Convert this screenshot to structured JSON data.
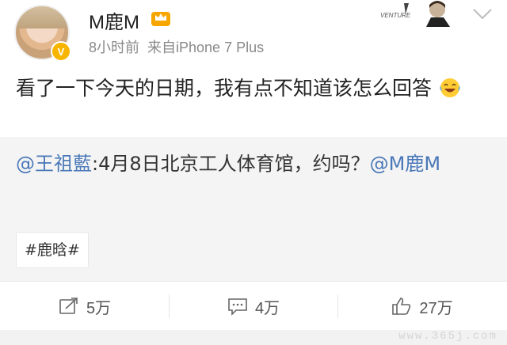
{
  "header": {
    "username": "M鹿M",
    "time": "8小时前",
    "source": "来自iPhone 7 Plus",
    "badge": "V",
    "banner_text": "VENTURE"
  },
  "post": {
    "text": "看了一下今天的日期，我有点不知道该怎么回答",
    "emoji": "laughing-tears"
  },
  "repost": {
    "mention": "@王祖藍",
    "text": ":4月8日北京工人体育馆，约吗？",
    "mention2": "@M鹿M"
  },
  "topic": {
    "label": "#鹿晗#"
  },
  "actions": {
    "repost_count": "5万",
    "comment_count": "4万",
    "like_count": "27万"
  },
  "watermark": "www.365j.com",
  "colors": {
    "link": "#4a78b8",
    "badge": "#f7b500",
    "meta": "#8a8a8a"
  }
}
